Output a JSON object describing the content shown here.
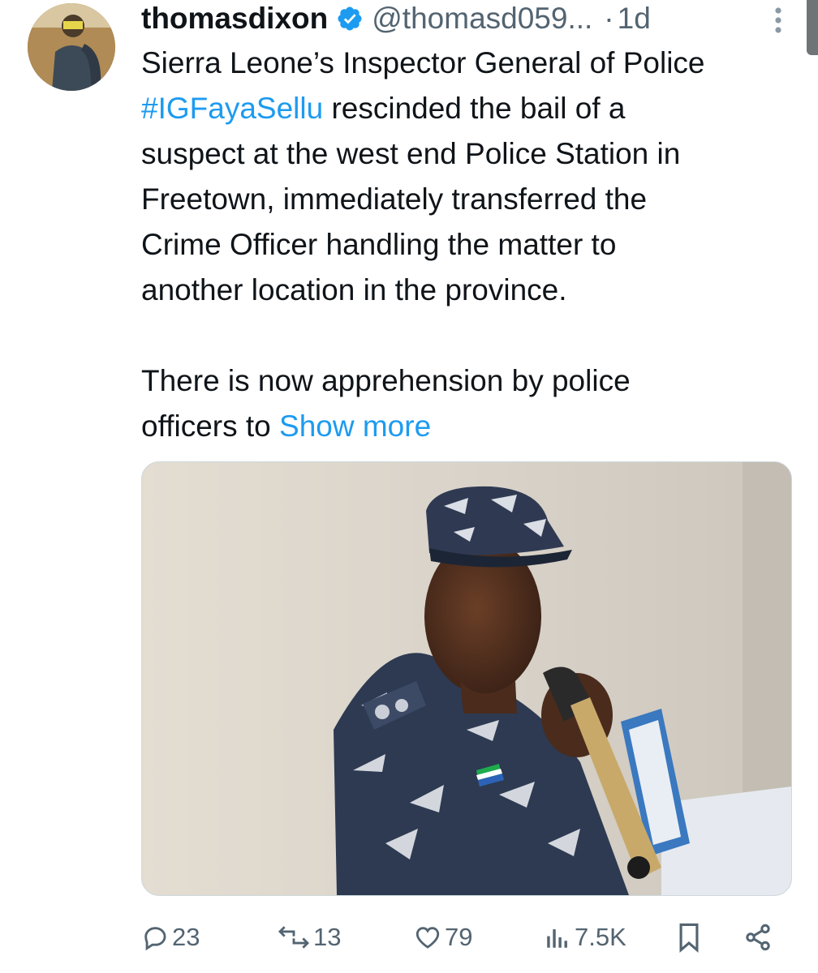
{
  "tweet": {
    "author": {
      "display_name": "thomasdixon",
      "handle": "@thomasd059...",
      "verified": true,
      "avatar_icon": "profile-photo"
    },
    "separator": "·",
    "timestamp": "1d",
    "hashtag": "#IGFayaSellu",
    "text_lines": [
      "Sierra Leone’s Inspector General of Police",
      "rescinded the bail of a",
      "suspect at the west end Police Station in",
      "Freetown, immediately transferred the",
      "Crime Officer handling  the matter to",
      "another location in the province."
    ],
    "text_para2_lines": [
      "There is now apprehension by police",
      "officers to"
    ],
    "show_more_label": "Show more",
    "media_description_icon": "photo-police-officer-speaking",
    "metrics": {
      "replies": "23",
      "retweets": "13",
      "likes": "79",
      "views": "7.5K"
    }
  },
  "colors": {
    "link": "#1d9bf0",
    "muted": "#536471",
    "text": "#0f1419"
  }
}
